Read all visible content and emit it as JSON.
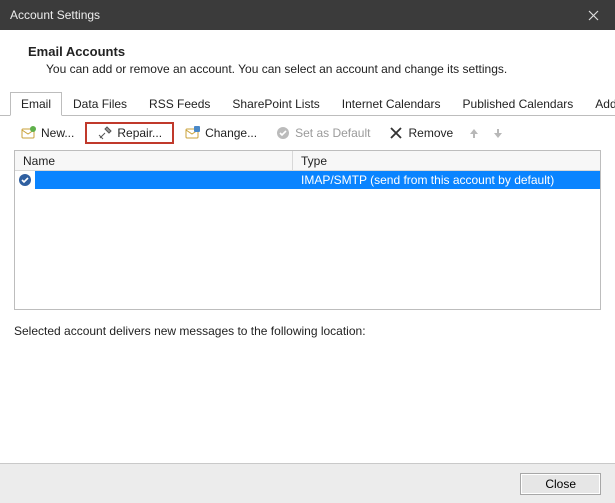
{
  "window": {
    "title": "Account Settings"
  },
  "header": {
    "title": "Email Accounts",
    "description": "You can add or remove an account. You can select an account and change its settings."
  },
  "tabs": [
    {
      "label": "Email",
      "active": true
    },
    {
      "label": "Data Files"
    },
    {
      "label": "RSS Feeds"
    },
    {
      "label": "SharePoint Lists"
    },
    {
      "label": "Internet Calendars"
    },
    {
      "label": "Published Calendars"
    },
    {
      "label": "Address Books"
    }
  ],
  "toolbar": {
    "new_label": "New...",
    "repair_label": "Repair...",
    "change_label": "Change...",
    "default_label": "Set as Default",
    "remove_label": "Remove"
  },
  "columns": {
    "name": "Name",
    "type": "Type"
  },
  "accounts": [
    {
      "name": "",
      "type": "IMAP/SMTP (send from this account by default)",
      "default": true,
      "selected": true
    }
  ],
  "location_text": "Selected account delivers new messages to the following location:",
  "footer": {
    "close_label": "Close"
  }
}
